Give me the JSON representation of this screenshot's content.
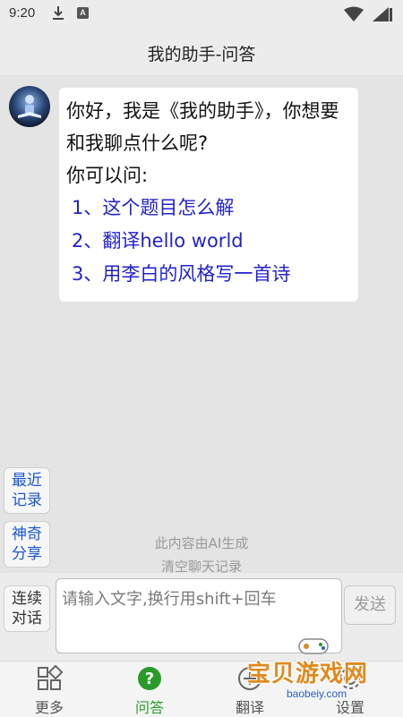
{
  "status_bar": {
    "time": "9:20",
    "icons": [
      "download-icon",
      "a-notification-icon",
      "wifi-icon",
      "battery-icon"
    ],
    "a_glyph": "A"
  },
  "header": {
    "title": "我的助手-问答"
  },
  "chat": {
    "greeting": "你好，我是《我的助手》，你想要和我聊点什么呢?",
    "prompt": "你可以问:",
    "suggestions": [
      "1、这个题目怎么解",
      "2、翻译hello world",
      "3、用李白的风格写一首诗"
    ],
    "ai_note": "此内容由AI生成",
    "clear_label": "清空聊天记录"
  },
  "side_buttons": {
    "recent": [
      "最近",
      "记录"
    ],
    "magic_share": [
      "神奇",
      "分享"
    ],
    "continuous": [
      "连续",
      "对话"
    ]
  },
  "input": {
    "placeholder": "请输入文字,换行用shift+回车",
    "send_label": "发送"
  },
  "nav": {
    "items": [
      {
        "label": "更多",
        "icon": "grid-icon",
        "active": false
      },
      {
        "label": "问答",
        "icon": "question-icon",
        "active": true
      },
      {
        "label": "翻译",
        "icon": "translate-icon",
        "active": false
      },
      {
        "label": "设置",
        "icon": "settings-icon",
        "active": false
      }
    ]
  },
  "watermark": {
    "text": "宝贝游戏网",
    "url": "baobeiy.com"
  },
  "colors": {
    "accent_green": "#2a9b2a",
    "link_blue": "#2222cc",
    "side_blue": "#1a56d6",
    "watermark_orange": "#e0891e"
  }
}
